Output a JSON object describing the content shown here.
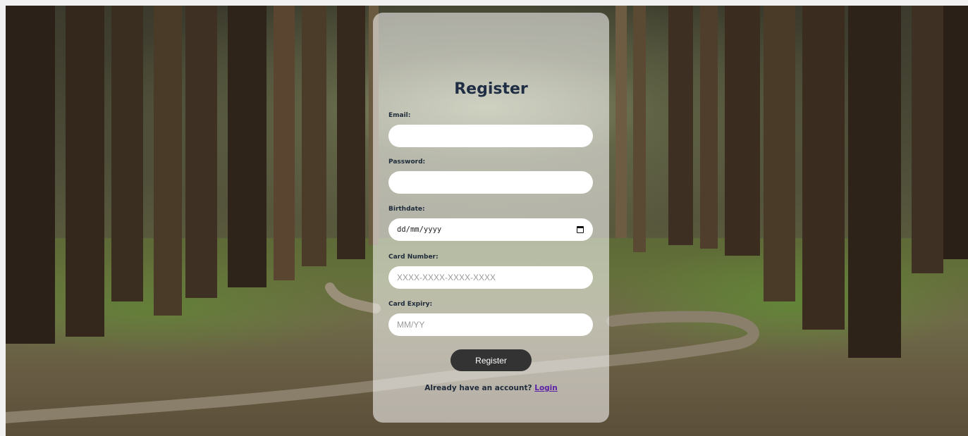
{
  "form": {
    "title": "Register",
    "email": {
      "label": "Email:",
      "value": "",
      "placeholder": ""
    },
    "password": {
      "label": "Password:",
      "value": "",
      "placeholder": ""
    },
    "birthdate": {
      "label": "Birthdate:",
      "value": "dd/mm/yyyy"
    },
    "card_number": {
      "label": "Card Number:",
      "placeholder": "XXXX-XXXX-XXXX-XXXX"
    },
    "card_expiry": {
      "label": "Card Expiry:",
      "placeholder": "MM/YY"
    },
    "submit_label": "Register",
    "footer_text": "Already have an account?",
    "login_link": "Login"
  },
  "icons": {
    "birthdate_picker": "calendar-icon"
  },
  "colors": {
    "button_bg": "#333333",
    "title": "#1f2e44",
    "link": "#5a1fa5"
  }
}
